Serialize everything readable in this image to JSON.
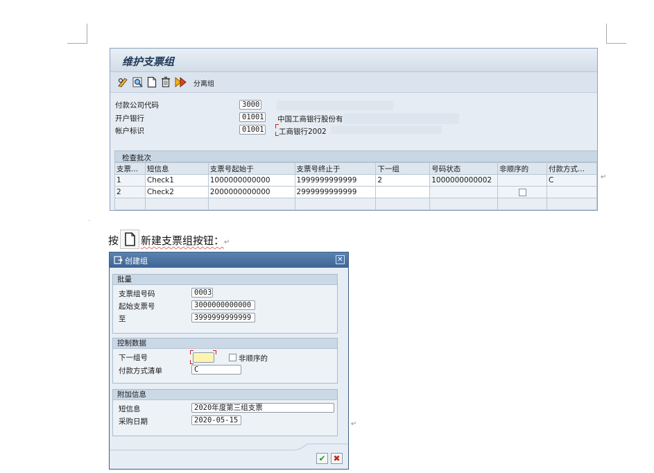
{
  "main_screen": {
    "title": "维护支票组",
    "toolbar": {
      "icons": [
        "pencil-glasses-icon",
        "search-icon",
        "new-document-icon",
        "trash-icon",
        "execute-icon"
      ],
      "separate_label": "分离组"
    },
    "fields": [
      {
        "label": "付款公司代码",
        "value": "3000",
        "desc": ""
      },
      {
        "label": "开户银行",
        "value": "01001",
        "desc": "中国工商银行股份有"
      },
      {
        "label": "帐户标识",
        "value": "01001",
        "desc": "工商银行2002"
      }
    ],
    "section_label": "检查批次",
    "table": {
      "headers": [
        "支票...",
        "短信息",
        "支票号起始于",
        "支票号终止于",
        "下一组",
        "号码状态",
        "非顺序的",
        "付款方式..."
      ],
      "rows": [
        [
          "1",
          "Check1",
          "1000000000000",
          "1999999999999",
          "2",
          "1000000000002",
          "",
          "C"
        ],
        [
          "2",
          "Check2",
          "2000000000000",
          "2999999999999",
          "",
          "",
          "",
          ""
        ]
      ]
    }
  },
  "caption": {
    "prefix": "按",
    "suffix": "新建支票组按钮：",
    "icon": "new-document-icon"
  },
  "dialog": {
    "title": "创建组",
    "groups": [
      {
        "title": "批量",
        "fields": [
          {
            "label": "支票组号码",
            "value": "0003"
          },
          {
            "label": "起始支票号",
            "value": "3000000000000"
          },
          {
            "label": "至",
            "value": "3999999999999"
          }
        ]
      },
      {
        "title": "控制数据",
        "fields": [
          {
            "label": "下一组号",
            "value": ""
          },
          {
            "label": "付款方式清单",
            "value": "C"
          }
        ],
        "checkbox_label": "非顺序的"
      },
      {
        "title": "附加信息",
        "fields": [
          {
            "label": "短信息",
            "value": "2020年度第三组支票"
          },
          {
            "label": "采购日期",
            "value": "2020-05-15"
          }
        ]
      }
    ],
    "buttons": {
      "confirm_icon": "checkmark-icon",
      "cancel_icon": "cancel-x-icon"
    }
  },
  "colors": {
    "title_bar": "#3e6494",
    "window_bg": "#e5ecf3",
    "required_marker": "#d01c1c",
    "input_focus": "#fff3b0"
  }
}
